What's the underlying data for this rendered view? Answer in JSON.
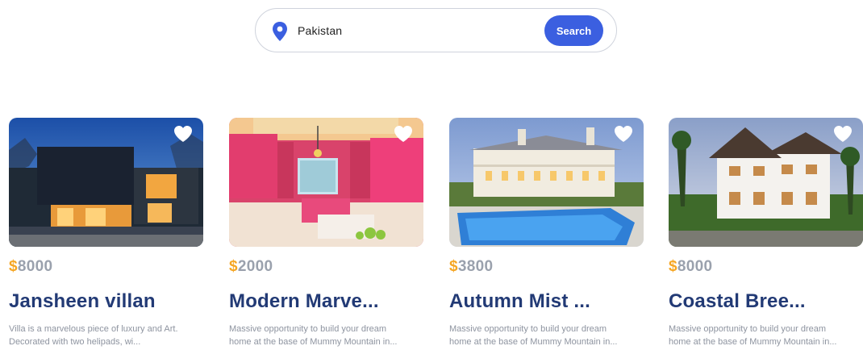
{
  "search": {
    "value": "Pakistan",
    "button_label": "Search",
    "icon": "map-pin-icon"
  },
  "colors": {
    "accent": "#3b5fe0",
    "price_symbol": "#f5a623",
    "title": "#223a75"
  },
  "listings": [
    {
      "currency": "$",
      "price": "8000",
      "title": "Jansheen villan",
      "description_line1": "Villa is a marvelous piece of luxury and Art.",
      "description_line2": "Decorated with two helipads, wi..."
    },
    {
      "currency": "$",
      "price": "2000",
      "title": "Modern Marve...",
      "description_line1": "Massive opportunity to build your dream",
      "description_line2": "home at the base of Mummy Mountain in..."
    },
    {
      "currency": "$",
      "price": "3800",
      "title": "Autumn Mist ...",
      "description_line1": "Massive opportunity to build your dream",
      "description_line2": "home at the base of Mummy Mountain in..."
    },
    {
      "currency": "$",
      "price": "8000",
      "title": "Coastal Bree...",
      "description_line1": "Massive opportunity to build your dream",
      "description_line2": "home at the base of Mummy Mountain in..."
    }
  ]
}
